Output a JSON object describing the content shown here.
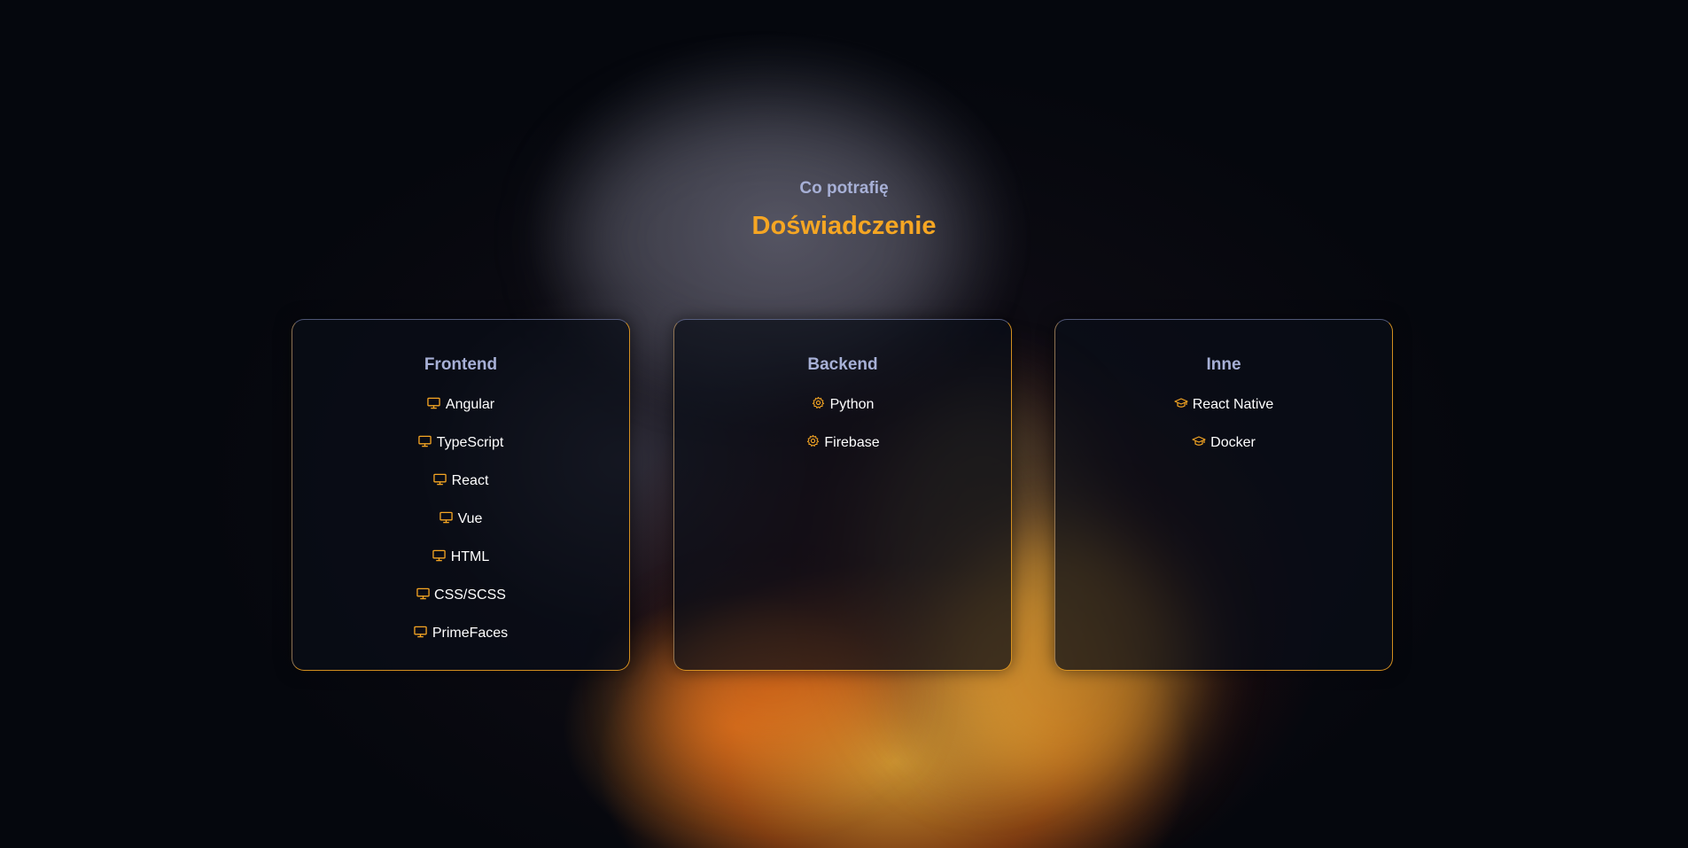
{
  "header": {
    "subtitle": "Co potrafię",
    "title": "Doświadczenie"
  },
  "colors": {
    "accent": "#f6a623",
    "muted": "#a7b0d6",
    "background": "#05070d"
  },
  "cards": [
    {
      "title": "Frontend",
      "icon": "monitor-icon",
      "items": [
        "Angular",
        "TypeScript",
        "React",
        "Vue",
        "HTML",
        "CSS/SCSS",
        "PrimeFaces"
      ]
    },
    {
      "title": "Backend",
      "icon": "gear-icon",
      "items": [
        "Python",
        "Firebase"
      ]
    },
    {
      "title": "Inne",
      "icon": "graduation-cap-icon",
      "items": [
        "React Native",
        "Docker"
      ]
    }
  ]
}
